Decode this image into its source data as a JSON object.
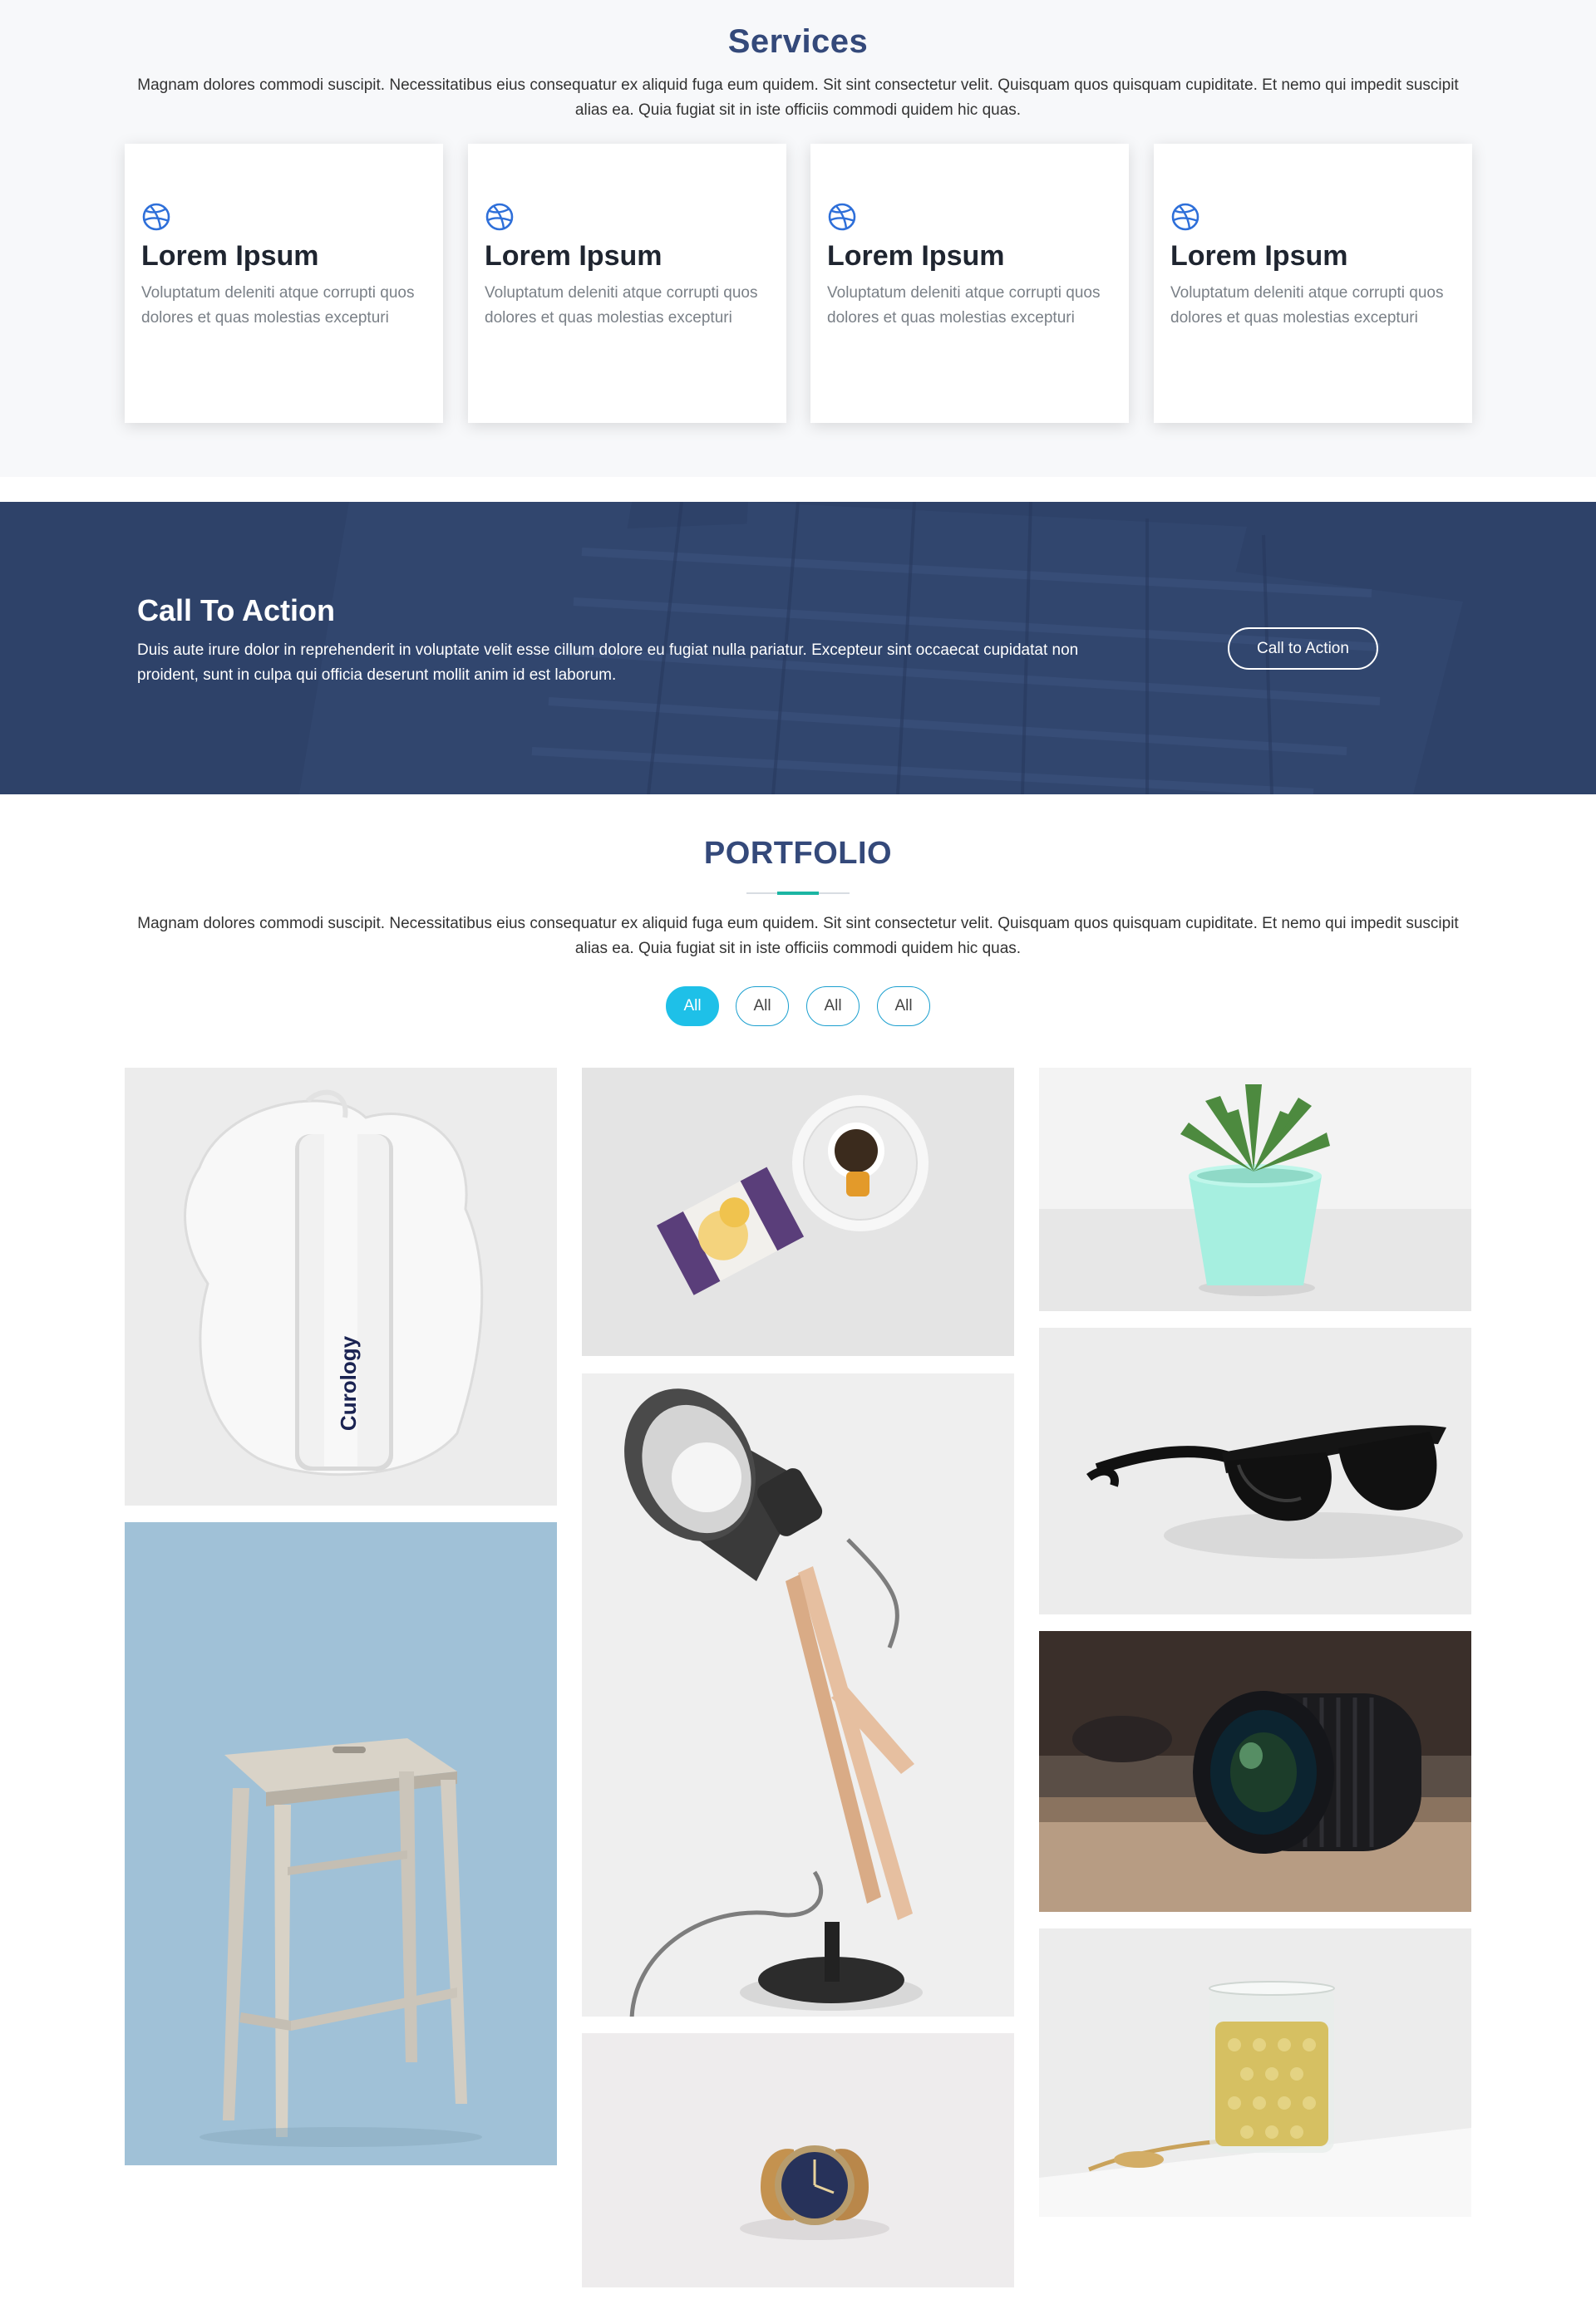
{
  "services": {
    "title": "Services",
    "description": "Magnam dolores commodi suscipit. Necessitatibus eius consequatur ex aliquid fuga eum quidem. Sit sint consectetur velit. Quisquam quos quisquam cupiditate. Et nemo qui impedit suscipit alias ea. Quia fugiat sit in iste officiis commodi quidem hic quas.",
    "icon": "dribbble-icon",
    "accent_color": "#2e6fd9",
    "cards": [
      {
        "title": "Lorem Ipsum",
        "text": "Voluptatum deleniti atque corrupti quos dolores et quas molestias excepturi"
      },
      {
        "title": "Lorem Ipsum",
        "text": "Voluptatum deleniti atque corrupti quos dolores et quas molestias excepturi"
      },
      {
        "title": "Lorem Ipsum",
        "text": "Voluptatum deleniti atque corrupti quos dolores et quas molestias excepturi"
      },
      {
        "title": "Lorem Ipsum",
        "text": "Voluptatum deleniti atque corrupti quos dolores et quas molestias excepturi"
      }
    ]
  },
  "cta": {
    "title": "Call To Action",
    "text": "Duis aute irure dolor in reprehenderit in voluptate velit esse cillum dolore eu fugiat nulla pariatur. Excepteur sint occaecat cupidatat non proident, sunt in culpa qui officia deserunt mollit anim id est laborum.",
    "button_label": "Call to Action",
    "background_color": "#2e4269"
  },
  "portfolio": {
    "title": "PORTFOLIO",
    "description": "Magnam dolores commodi suscipit. Necessitatibus eius consequatur ex aliquid fuga eum quidem. Sit sint consectetur velit. Quisquam quos quisquam cupiditate. Et nemo qui impedit suscipit alias ea. Quia fugiat sit in iste officiis commodi quidem hic quas.",
    "filters": [
      {
        "label": "All",
        "active": true
      },
      {
        "label": "All",
        "active": false
      },
      {
        "label": "All",
        "active": false
      },
      {
        "label": "All",
        "active": false
      }
    ],
    "filter_active_color": "#1ec0e8",
    "items": [
      {
        "name": "skincare-bottle-image",
        "product_text": "Curology"
      },
      {
        "name": "wooden-stool-image"
      },
      {
        "name": "tea-and-honey-image"
      },
      {
        "name": "desk-lamp-image"
      },
      {
        "name": "wristwatch-image"
      },
      {
        "name": "potted-succulent-image"
      },
      {
        "name": "sunglasses-image"
      },
      {
        "name": "camera-lens-image"
      },
      {
        "name": "glass-of-tea-image"
      }
    ]
  }
}
